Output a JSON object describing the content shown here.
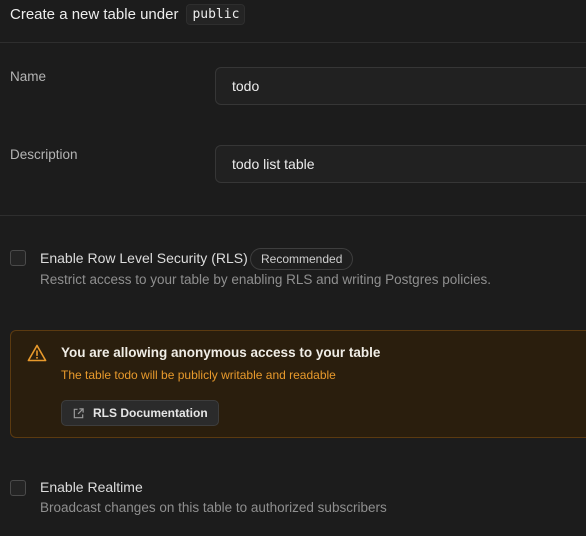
{
  "header": {
    "title": "Create a new table under",
    "schema": "public"
  },
  "form": {
    "name": {
      "label": "Name",
      "value": "todo"
    },
    "description": {
      "label": "Description",
      "value": "todo list table"
    }
  },
  "rls": {
    "title": "Enable Row Level Security (RLS)",
    "badge": "Recommended",
    "description": "Restrict access to your table by enabling RLS and writing Postgres policies.",
    "checked": false
  },
  "warning": {
    "icon": "warning-triangle-icon",
    "title": "You are allowing anonymous access to your table",
    "subtitle": "The table todo will be publicly writable and readable",
    "button_label": "RLS Documentation",
    "button_icon": "external-link-icon"
  },
  "realtime": {
    "title": "Enable Realtime",
    "description": "Broadcast changes on this table to authorized subscribers",
    "checked": false
  },
  "colors": {
    "background": "#1c1c1c",
    "warning_bg": "#2a1e0d",
    "warning_border": "#5b3a10",
    "warning_text": "#e89a2c"
  }
}
